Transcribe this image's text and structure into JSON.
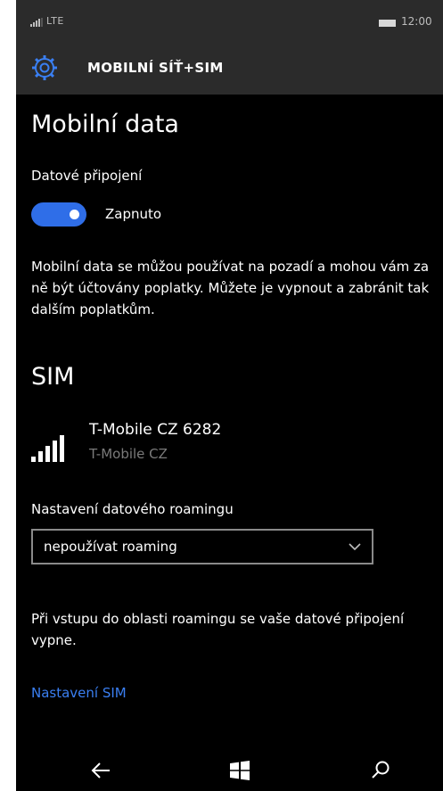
{
  "status_bar": {
    "network": "LTE",
    "time": "12:00"
  },
  "header": {
    "icon": "gear-icon",
    "title": "MOBILNÍ SÍŤ+SIM"
  },
  "mobile_data": {
    "heading": "Mobilní data",
    "connection_label": "Datové připojení",
    "toggle_on": true,
    "toggle_state_label": "Zapnuto",
    "description": "Mobilní data se můžou používat na pozadí a mohou vám za ně být účtovány poplatky. Můžete je vypnout a zabránit tak dalším poplatkům."
  },
  "sim": {
    "heading": "SIM",
    "name": "T-Mobile CZ 6282",
    "operator": "T-Mobile CZ",
    "roaming_label": "Nastavení datového roamingu",
    "roaming_selected": "nepoužívat roaming",
    "roaming_note": "Při vstupu do oblasti roamingu se vaše datové připojení vypne.",
    "settings_link": "Nastavení SIM"
  },
  "navbar": {
    "back": "back-arrow-icon",
    "start": "windows-logo-icon",
    "search": "search-icon"
  },
  "colors": {
    "accent": "#2f6ee8",
    "link": "#3a7ff2",
    "header_bg": "#2b2b2b",
    "background": "#000000"
  }
}
